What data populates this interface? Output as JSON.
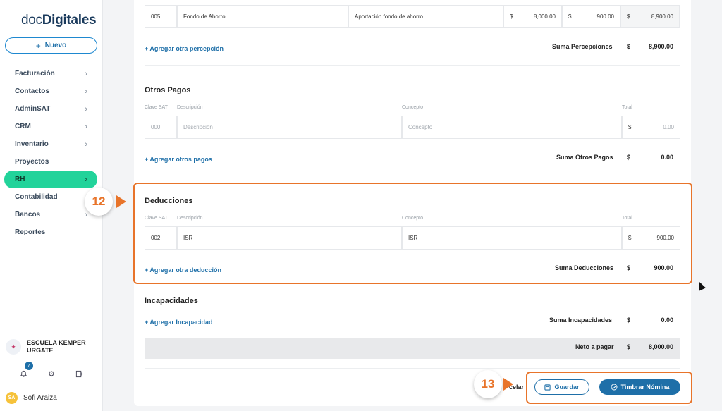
{
  "app": {
    "logo_prefix": "doc",
    "logo_bold": "Digitales"
  },
  "sidebar": {
    "new_button": "Nuevo",
    "items": [
      {
        "label": "Facturación",
        "chevron": true
      },
      {
        "label": "Contactos",
        "chevron": true
      },
      {
        "label": "AdminSAT",
        "chevron": true
      },
      {
        "label": "CRM",
        "chevron": true
      },
      {
        "label": "Inventario",
        "chevron": true
      },
      {
        "label": "Proyectos",
        "chevron": false
      },
      {
        "label": "RH",
        "chevron": true,
        "active": true
      },
      {
        "label": "Contabilidad",
        "chevron": false
      },
      {
        "label": "Bancos",
        "chevron": true
      },
      {
        "label": "Reportes",
        "chevron": false
      }
    ],
    "company": {
      "line1": "ESCUELA KEMPER",
      "line2": "URGATE"
    },
    "notifications_count": "7",
    "user": {
      "initials": "SA",
      "name": "Sofi Araiza"
    }
  },
  "percepciones": {
    "row": {
      "clave": "005",
      "descripcion": "Fondo de Ahorro",
      "concepto": "Aportación fondo de ahorro",
      "currency1": "$",
      "gravado": "8,000.00",
      "currency2": "$",
      "exento": "900.00",
      "currency3": "$",
      "total": "8,900.00"
    },
    "add_link": "+ Agregar otra percepción",
    "sum_label": "Suma Percepciones",
    "sum_currency": "$",
    "sum_value": "8,900.00"
  },
  "otros_pagos": {
    "title": "Otros Pagos",
    "headers": {
      "clave": "Clave SAT",
      "descripcion": "Descripción",
      "concepto": "Concepto",
      "total": "Total"
    },
    "row": {
      "clave": "000",
      "descripcion": "Descripción",
      "concepto": "Concepto",
      "currency": "$",
      "total": "0.00"
    },
    "add_link": "+ Agregar otros pagos",
    "sum_label": "Suma Otros Pagos",
    "sum_currency": "$",
    "sum_value": "0.00"
  },
  "deducciones": {
    "title": "Deducciones",
    "headers": {
      "clave": "Clave SAT",
      "descripcion": "Descripción",
      "concepto": "Concepto",
      "total": "Total"
    },
    "row": {
      "clave": "002",
      "descripcion": "ISR",
      "concepto": "ISR",
      "currency": "$",
      "total": "900.00"
    },
    "add_link": "+ Agregar otra deducción",
    "sum_label": "Suma Deducciones",
    "sum_currency": "$",
    "sum_value": "900.00"
  },
  "incapacidades": {
    "title": "Incapacidades",
    "add_link": "+ Agregar Incapacidad",
    "sum_label": "Suma Incapacidades",
    "sum_currency": "$",
    "sum_value": "0.00"
  },
  "neto": {
    "label": "Neto a pagar",
    "currency": "$",
    "value": "8,000.00"
  },
  "footer": {
    "cancel_partial": "celar",
    "save": "Guardar",
    "stamp": "Timbrar Nómina"
  },
  "annotations": {
    "step_a": "12",
    "step_b": "13",
    "color": "#e8742a"
  }
}
